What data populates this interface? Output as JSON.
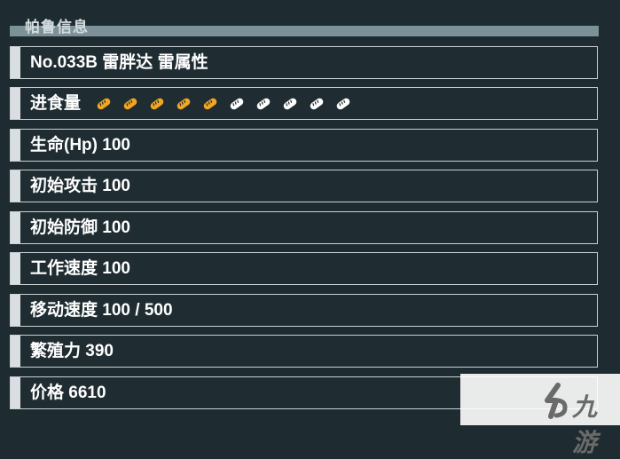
{
  "header": {
    "title": "帕鲁信息"
  },
  "rows": [
    {
      "text": "No.033B 雷胖达 雷属性"
    },
    {
      "text": "进食量",
      "food": {
        "filled": 5,
        "total": 10
      }
    },
    {
      "text": "生命(Hp) 100"
    },
    {
      "text": "初始攻击 100"
    },
    {
      "text": "初始防御 100"
    },
    {
      "text": "工作速度 100"
    },
    {
      "text": "移动速度 100 / 500"
    },
    {
      "text": "繁殖力 390"
    },
    {
      "text": "价格 6610"
    }
  ],
  "food_icon": {
    "name": "bread-icon",
    "filled_color": "#f2a622",
    "empty_color": "#ffffff"
  },
  "watermark": {
    "text": "九游",
    "logo": "jiuyou-logo"
  }
}
